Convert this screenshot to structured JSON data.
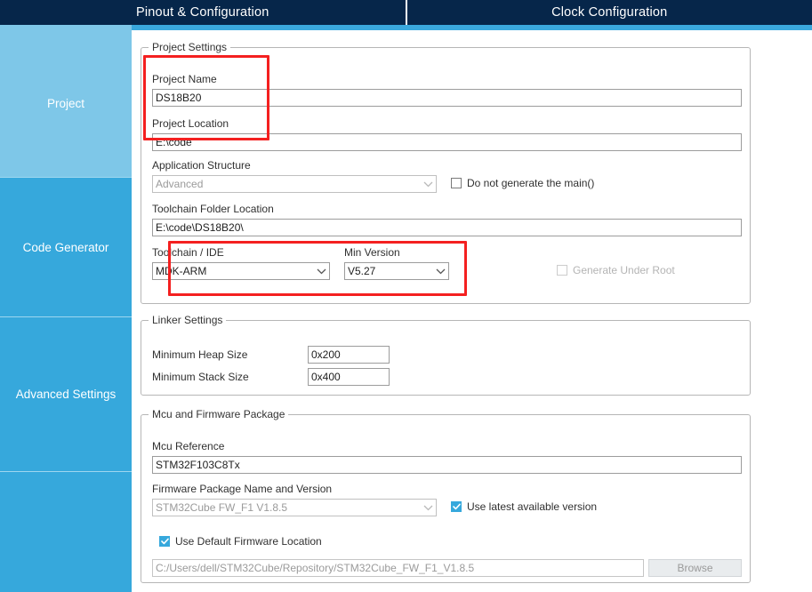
{
  "header": {
    "tabs": [
      {
        "label": "Pinout & Configuration"
      },
      {
        "label": "Clock Configuration"
      }
    ]
  },
  "sidebar": {
    "items": [
      {
        "label": "Project",
        "active": true
      },
      {
        "label": "Code Generator",
        "active": false
      },
      {
        "label": "Advanced Settings",
        "active": false
      },
      {
        "label": "",
        "active": false
      }
    ]
  },
  "project_settings": {
    "legend": "Project Settings",
    "project_name_label": "Project Name",
    "project_name_value": "DS18B20",
    "project_location_label": "Project Location",
    "project_location_value": "E:\\code",
    "application_structure_label": "Application Structure",
    "application_structure_value": "Advanced",
    "do_not_generate_main_label": "Do not generate the main()",
    "toolchain_folder_label": "Toolchain Folder Location",
    "toolchain_folder_value": "E:\\code\\DS18B20\\",
    "toolchain_ide_label": "Toolchain / IDE",
    "toolchain_ide_value": "MDK-ARM",
    "min_version_label": "Min Version",
    "min_version_value": "V5.27",
    "generate_under_root_label": "Generate Under Root"
  },
  "linker_settings": {
    "legend": "Linker Settings",
    "min_heap_label": "Minimum Heap Size",
    "min_heap_value": "0x200",
    "min_stack_label": "Minimum Stack Size",
    "min_stack_value": "0x400"
  },
  "mcu_firmware": {
    "legend": "Mcu and Firmware Package",
    "mcu_reference_label": "Mcu Reference",
    "mcu_reference_value": "STM32F103C8Tx",
    "firmware_package_label": "Firmware Package Name and Version",
    "firmware_package_value": "STM32Cube FW_F1 V1.8.5",
    "use_latest_label": "Use latest available version",
    "use_default_location_label": "Use Default Firmware Location",
    "firmware_path_value": "C:/Users/dell/STM32Cube/Repository/STM32Cube_FW_F1_V1.8.5",
    "browse_label": "Browse"
  },
  "colors": {
    "header_bg": "#06264a",
    "accent": "#36a8dc",
    "accent_light": "#7ec7e8",
    "highlight": "#f42020"
  }
}
